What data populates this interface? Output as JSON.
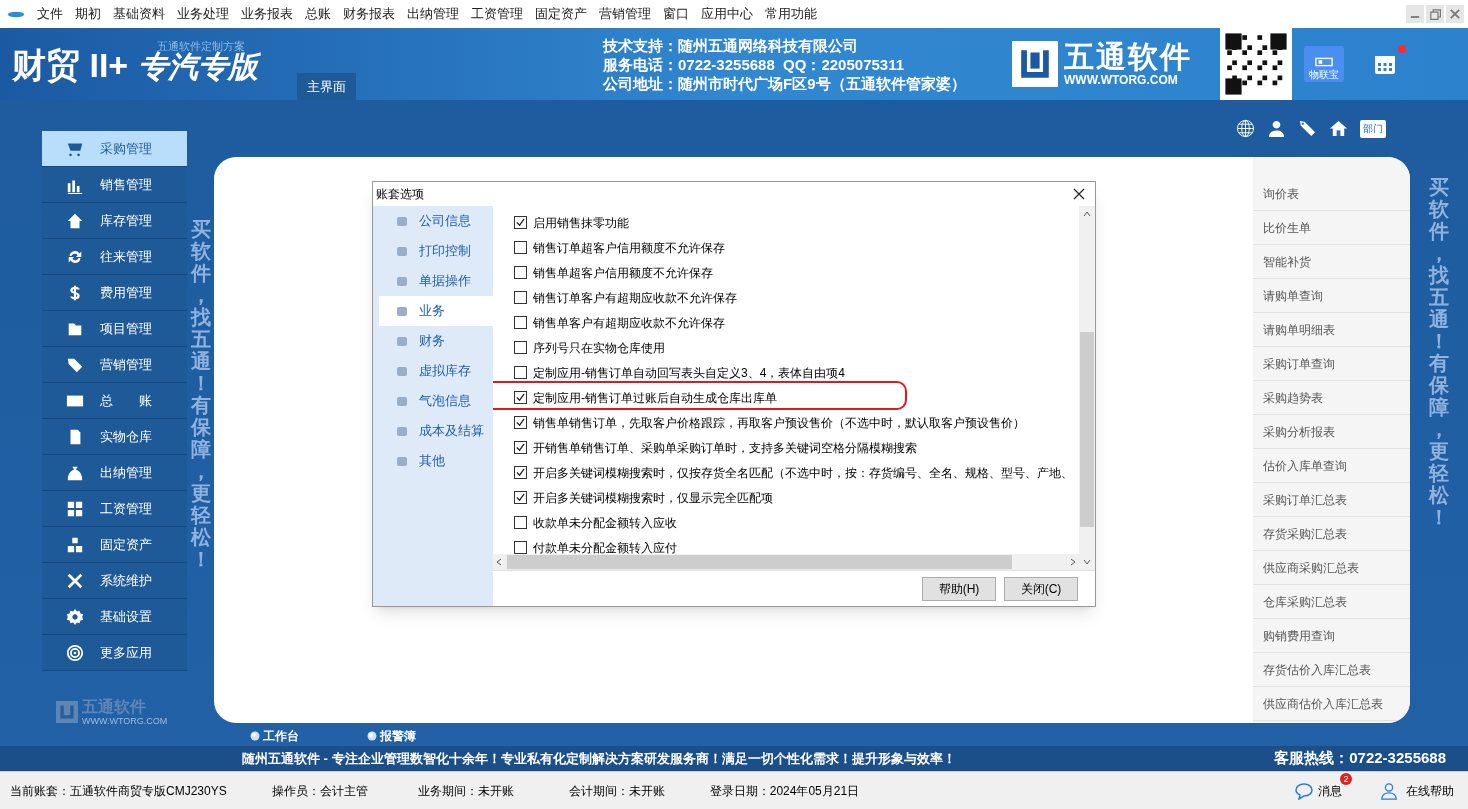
{
  "menu_bar": [
    "文件",
    "期初",
    "基础资料",
    "业务处理",
    "业务报表",
    "总账",
    "财务报表",
    "出纳管理",
    "工资管理",
    "固定资产",
    "营销管理",
    "窗口",
    "应用中心",
    "常用功能"
  ],
  "header": {
    "title": "财贸 II+",
    "edition": "专汽专版",
    "tagline": "五通软件定制方案",
    "tab": {
      "label": "主界面",
      "selected": true
    },
    "support_lines": [
      "技术支持：随州五通网络科技有限公司",
      "服务电话：0722-3255688  QQ：2205075311",
      "公司地址：随州市时代广场F区9号（五通软件管家婆）"
    ],
    "brand": {
      "name": "五通软件",
      "url": "WWW.WTORG.COM"
    },
    "iot_button": "物联宝",
    "department_sign": "部门"
  },
  "nav": [
    {
      "label": "采购管理",
      "selected": true
    },
    {
      "label": "销售管理",
      "selected": false
    },
    {
      "label": "库存管理",
      "selected": false
    },
    {
      "label": "往来管理",
      "selected": false
    },
    {
      "label": "费用管理",
      "selected": false
    },
    {
      "label": "项目管理",
      "selected": false
    },
    {
      "label": "营销管理",
      "selected": false
    },
    {
      "label": "总　　账",
      "selected": false
    },
    {
      "label": "实物仓库",
      "selected": false
    },
    {
      "label": "出纳管理",
      "selected": false
    },
    {
      "label": "工资管理",
      "selected": false
    },
    {
      "label": "固定资产",
      "selected": false
    },
    {
      "label": "系统维护",
      "selected": false
    },
    {
      "label": "基础设置",
      "selected": false
    },
    {
      "label": "更多应用",
      "selected": false
    }
  ],
  "left_slogan": "买软件，找五通！有保障，更轻松！",
  "dialog": {
    "title": "账套选项",
    "nav": [
      {
        "label": "公司信息",
        "selected": false
      },
      {
        "label": "打印控制",
        "selected": false
      },
      {
        "label": "单据操作",
        "selected": false
      },
      {
        "label": "业务",
        "selected": true
      },
      {
        "label": "财务",
        "selected": false
      },
      {
        "label": "虚拟库存",
        "selected": false
      },
      {
        "label": "气泡信息",
        "selected": false
      },
      {
        "label": "成本及结算",
        "selected": false
      },
      {
        "label": "其他",
        "selected": false
      }
    ],
    "options": [
      {
        "label": "启用销售抹零功能",
        "checked": true,
        "highlighted": false
      },
      {
        "label": "销售订单超客户信用额度不允许保存",
        "checked": false,
        "highlighted": false
      },
      {
        "label": "销售单超客户信用额度不允许保存",
        "checked": false,
        "highlighted": false
      },
      {
        "label": "销售订单客户有超期应收款不允许保存",
        "checked": false,
        "highlighted": false
      },
      {
        "label": "销售单客户有超期应收款不允许保存",
        "checked": false,
        "highlighted": false
      },
      {
        "label": "序列号只在实物仓库使用",
        "checked": false,
        "highlighted": false
      },
      {
        "label": "定制应用-销售订单自动回写表头自定义3、4，表体自由项4",
        "checked": false,
        "highlighted": false
      },
      {
        "label": "定制应用-销售订单过账后自动生成仓库出库单",
        "checked": true,
        "highlighted": true
      },
      {
        "label": "销售单销售订单，先取客户价格跟踪，再取客户预设售价（不选中时，默认取客户预设售价）",
        "checked": true,
        "highlighted": false
      },
      {
        "label": "开销售单销售订单、采购单采购订单时，支持多关键词空格分隔模糊搜索",
        "checked": true,
        "highlighted": false
      },
      {
        "label": "开启多关键词模糊搜索时，仅按存货全名匹配（不选中时，按：存货编号、全名、规格、型号、产地、",
        "checked": true,
        "highlighted": false
      },
      {
        "label": "开启多关键词模糊搜索时，仅显示完全匹配项",
        "checked": true,
        "highlighted": false
      },
      {
        "label": "收款单未分配金额转入应收",
        "checked": false,
        "highlighted": false
      },
      {
        "label": "付款单未分配金额转入应付",
        "checked": false,
        "highlighted": false
      }
    ],
    "buttons": [
      "帮助(H)",
      "关闭(C)"
    ]
  },
  "quick_links": [
    "询价表",
    "比价生单",
    "智能补货",
    "请购单查询",
    "请购单明细表",
    "采购订单查询",
    "采购趋势表",
    "采购分析报表",
    "估价入库单查询",
    "采购订单汇总表",
    "存货采购汇总表",
    "供应商采购汇总表",
    "仓库采购汇总表",
    "购销费用查询",
    "存货估价入库汇总表",
    "供应商估价入库汇总表"
  ],
  "right_slogan": "买软件，找五通！有保障，更轻松！",
  "bottom_logo": {
    "name": "五通软件",
    "url": "WWW.WTORG.COM"
  },
  "bottom_links": [
    "工作台",
    "报警簿"
  ],
  "banner": "随州五通软件 - 专注企业管理数智化十余年！专业私有化定制解决方案研发服务商！满足一切个性化需求！提升形象与效率！",
  "hotline": "客服热线：0722-3255688",
  "status_bar": {
    "fields": [
      "当前账套：五通软件商贸专版CMJ230YS",
      "操作员：会计主管",
      "业务期间：未开账",
      "会计期间：未开账",
      "登录日期：2024年05月21日"
    ],
    "messages": {
      "label": "消息",
      "count": "2"
    },
    "help": "在线帮助"
  }
}
